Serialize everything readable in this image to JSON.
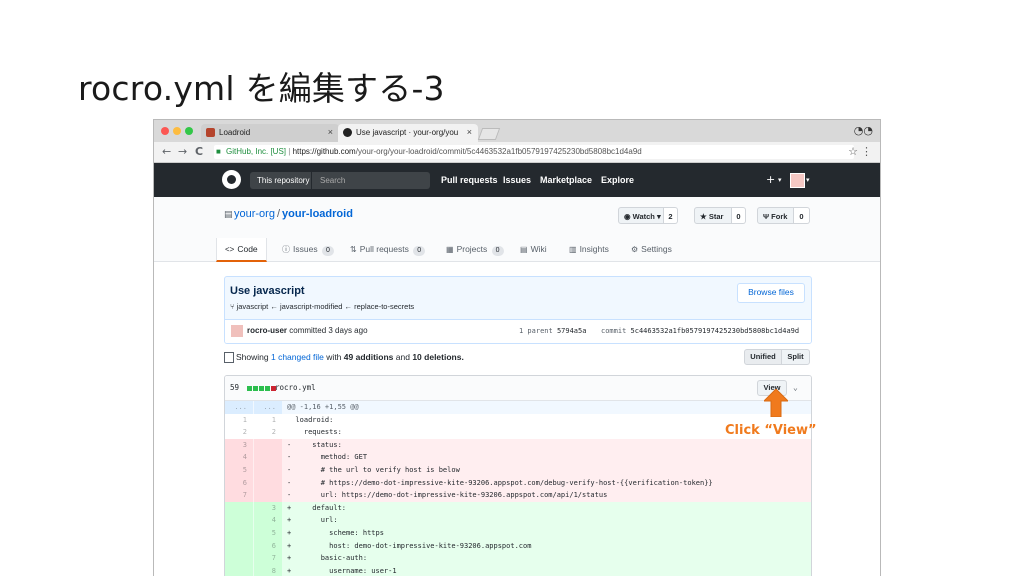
{
  "slide": {
    "title": "rocro.yml を編集する-3"
  },
  "browser": {
    "tabs": [
      {
        "label": "Loadroid",
        "close": "×"
      },
      {
        "label": "Use javascript · your-org/you",
        "close": "×"
      }
    ],
    "nav": {
      "back": "←",
      "forward": "→",
      "reload": "C"
    },
    "url": {
      "secure_label": "GitHub, Inc. [US]",
      "separator": "|",
      "scheme_host": "https://github.com",
      "path": "/your-org/your-loadroid/commit/5c4463532a1fb0579197425230bd5808bc1d4a9d"
    },
    "star": "☆",
    "menu": "⋮"
  },
  "github_header": {
    "search_scope": "This repository",
    "search_placeholder": "Search",
    "nav": [
      "Pull requests",
      "Issues",
      "Marketplace",
      "Explore"
    ],
    "plus": "+"
  },
  "repo": {
    "owner": "your-org",
    "name": "your-loadroid",
    "watch": {
      "label": "Watch ▾",
      "count": "2"
    },
    "star": {
      "label": "Star",
      "count": "0"
    },
    "fork": {
      "label": "Fork",
      "count": "0"
    },
    "tabs": [
      {
        "label": "Code",
        "icon": "<>",
        "count": ""
      },
      {
        "label": "Issues",
        "icon": "ⓘ",
        "count": "0"
      },
      {
        "label": "Pull requests",
        "icon": "⇅",
        "count": "0"
      },
      {
        "label": "Projects",
        "icon": "▦",
        "count": "0"
      },
      {
        "label": "Wiki",
        "icon": "▤",
        "count": ""
      },
      {
        "label": "Insights",
        "icon": "▥",
        "count": ""
      },
      {
        "label": "Settings",
        "icon": "⚙",
        "count": ""
      }
    ]
  },
  "commit": {
    "title": "Use javascript",
    "branches": "javascript  ←  javascript-modified  ←  replace-to-secrets",
    "browse_files": "Browse files",
    "author": "rocro-user",
    "committed": "committed 3 days ago",
    "parent_label": "1 parent",
    "parent_sha": "5794a5a",
    "commit_label": "commit",
    "commit_sha": "5c4463532a1fb0579197425230bd5808bc1d4a9d"
  },
  "toc": {
    "showing": "Showing",
    "changed": "1 changed file",
    "with": "with",
    "additions": "49 additions",
    "and": "and",
    "deletions": "10 deletions.",
    "unified": "Unified",
    "split": "Split"
  },
  "file": {
    "count": "59",
    "name": "rocro.yml",
    "view": "View",
    "chevron": "⌄"
  },
  "diff": [
    {
      "type": "hunk",
      "old": "...",
      "new": "...",
      "code": "@@ -1,16 +1,55 @@"
    },
    {
      "type": "ctx",
      "old": "1",
      "new": "1",
      "code": "  loadroid:"
    },
    {
      "type": "ctx",
      "old": "2",
      "new": "2",
      "code": "    requests:"
    },
    {
      "type": "del",
      "old": "3",
      "new": "",
      "code": "-     status:"
    },
    {
      "type": "del",
      "old": "4",
      "new": "",
      "code": "-       method: GET"
    },
    {
      "type": "del",
      "old": "5",
      "new": "",
      "code": "-       # the url to verify host is below"
    },
    {
      "type": "del",
      "old": "6",
      "new": "",
      "code": "-       # https://demo-dot-impressive-kite-93206.appspot.com/debug-verify-host-{{verification-token}}"
    },
    {
      "type": "del",
      "old": "7",
      "new": "",
      "code": "-       url: https://demo-dot-impressive-kite-93206.appspot.com/api/1/status"
    },
    {
      "type": "add",
      "old": "",
      "new": "3",
      "code": "+     default:"
    },
    {
      "type": "add",
      "old": "",
      "new": "4",
      "code": "+       url:"
    },
    {
      "type": "add",
      "old": "",
      "new": "5",
      "code": "+         scheme: https"
    },
    {
      "type": "add",
      "old": "",
      "new": "6",
      "code": "+         host: demo-dot-impressive-kite-93206.appspot.com"
    },
    {
      "type": "add",
      "old": "",
      "new": "7",
      "code": "+       basic-auth:"
    },
    {
      "type": "add",
      "old": "",
      "new": "8",
      "code": "+         username: user-1"
    }
  ],
  "annotation": {
    "label": "Click “View”",
    "color": "#f07a1d"
  }
}
